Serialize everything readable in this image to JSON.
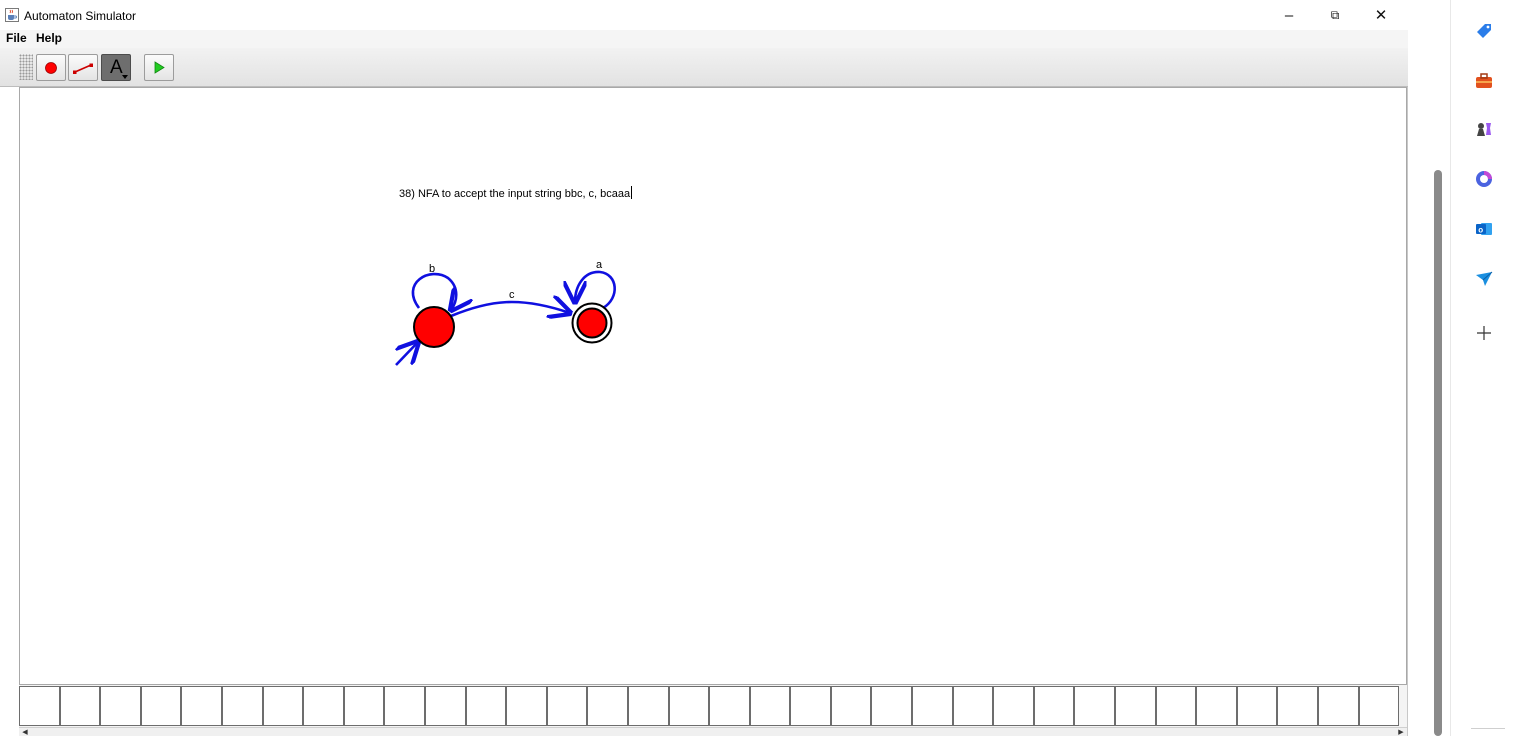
{
  "window": {
    "title": "Automaton Simulator",
    "controls": {
      "minimize": "–",
      "restore": "⧉",
      "close": "✕"
    }
  },
  "menu": {
    "items": [
      "File",
      "Help"
    ]
  },
  "toolbar": {
    "tools": [
      {
        "name": "add-state-tool",
        "icon": "red-dot-icon"
      },
      {
        "name": "add-transition-tool",
        "icon": "arrow-line-icon"
      },
      {
        "name": "text-tool",
        "icon": "letter-a-icon",
        "label": "A",
        "selected": true
      },
      {
        "name": "run-tool",
        "icon": "play-icon"
      }
    ]
  },
  "canvas": {
    "note": "38) NFA to accept the input string bbc, c, bcaaa",
    "states": [
      {
        "id": "q0",
        "initial": true,
        "accepting": false,
        "self_loop_label": "b"
      },
      {
        "id": "q1",
        "initial": false,
        "accepting": true,
        "self_loop_label": "a"
      }
    ],
    "transitions": [
      {
        "from": "q0",
        "to": "q0",
        "label": "b"
      },
      {
        "from": "q0",
        "to": "q1",
        "label": "c"
      },
      {
        "from": "q1",
        "to": "q1",
        "label": "a"
      }
    ],
    "colors": {
      "state_fill": "#ff0000",
      "edge": "#1010e0",
      "accent_toolbar": "#6e6e6e"
    }
  },
  "tape": {
    "cell_count": 34
  },
  "edge_sidebar": {
    "icons": [
      "tag-icon",
      "briefcase-icon",
      "chess-icon",
      "copilot-icon",
      "outlook-icon",
      "send-icon",
      "plus-icon"
    ]
  }
}
